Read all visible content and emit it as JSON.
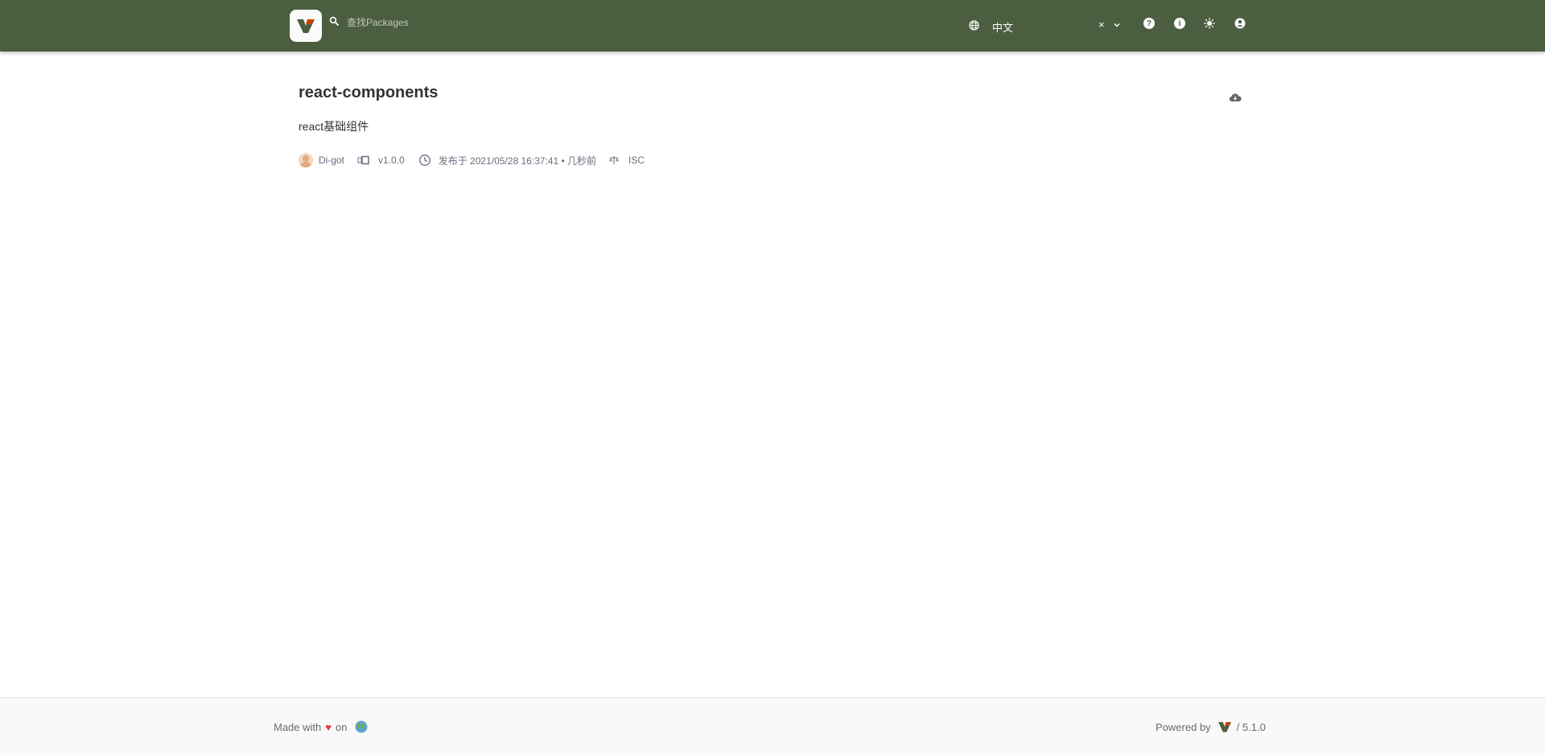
{
  "header": {
    "search_placeholder": "查找Packages",
    "language": {
      "selected": "中文",
      "clear_label": "×"
    },
    "icons": {
      "help": "help-icon",
      "info": "info-icon",
      "theme": "sun-icon",
      "account": "account-icon"
    }
  },
  "package": {
    "name": "react-components",
    "description": "react基础组件",
    "author": "Di-got",
    "version": "v1.0.0",
    "published": "发布于 2021/05/28 16:37:41 • 几秒前",
    "license": "ISC"
  },
  "footer": {
    "made_with": "Made with",
    "on": "on",
    "powered_by": "Powered by",
    "version": "/ 5.1.0"
  },
  "colors": {
    "header_bg": "#4b5e40",
    "logo_green": "#4b5e40",
    "logo_orange": "#cd4000",
    "heart": "#e53935"
  }
}
